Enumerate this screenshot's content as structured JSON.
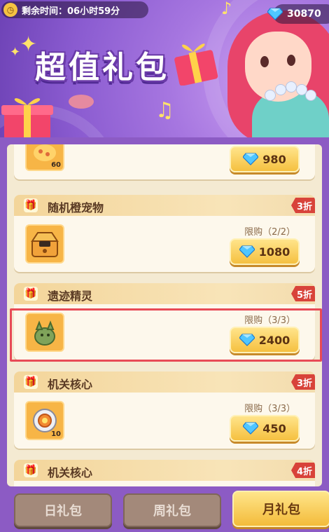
{
  "header": {
    "timer_label": "剩余时间：06小时59分",
    "currency_amount": "30870"
  },
  "banner": {
    "title": "超值礼包"
  },
  "packs": [
    {
      "title": "",
      "price": "980",
      "qty": "60"
    },
    {
      "title": "随机橙宠物",
      "discount": "3折",
      "limit": "限购（2/2）",
      "price": "1080"
    },
    {
      "title": "遗迹精灵",
      "discount": "5折",
      "limit": "限购（3/3）",
      "price": "2400"
    },
    {
      "title": "机关核心",
      "discount": "3折",
      "limit": "限购（3/3）",
      "price": "450",
      "qty": "10"
    },
    {
      "title": "机关核心",
      "discount": "4折"
    }
  ],
  "tabs": {
    "daily": "日礼包",
    "weekly": "周礼包",
    "monthly": "月礼包"
  },
  "colors": {
    "accent": "#f5c040",
    "discount": "#d8433a",
    "highlight": "#e84a56"
  }
}
